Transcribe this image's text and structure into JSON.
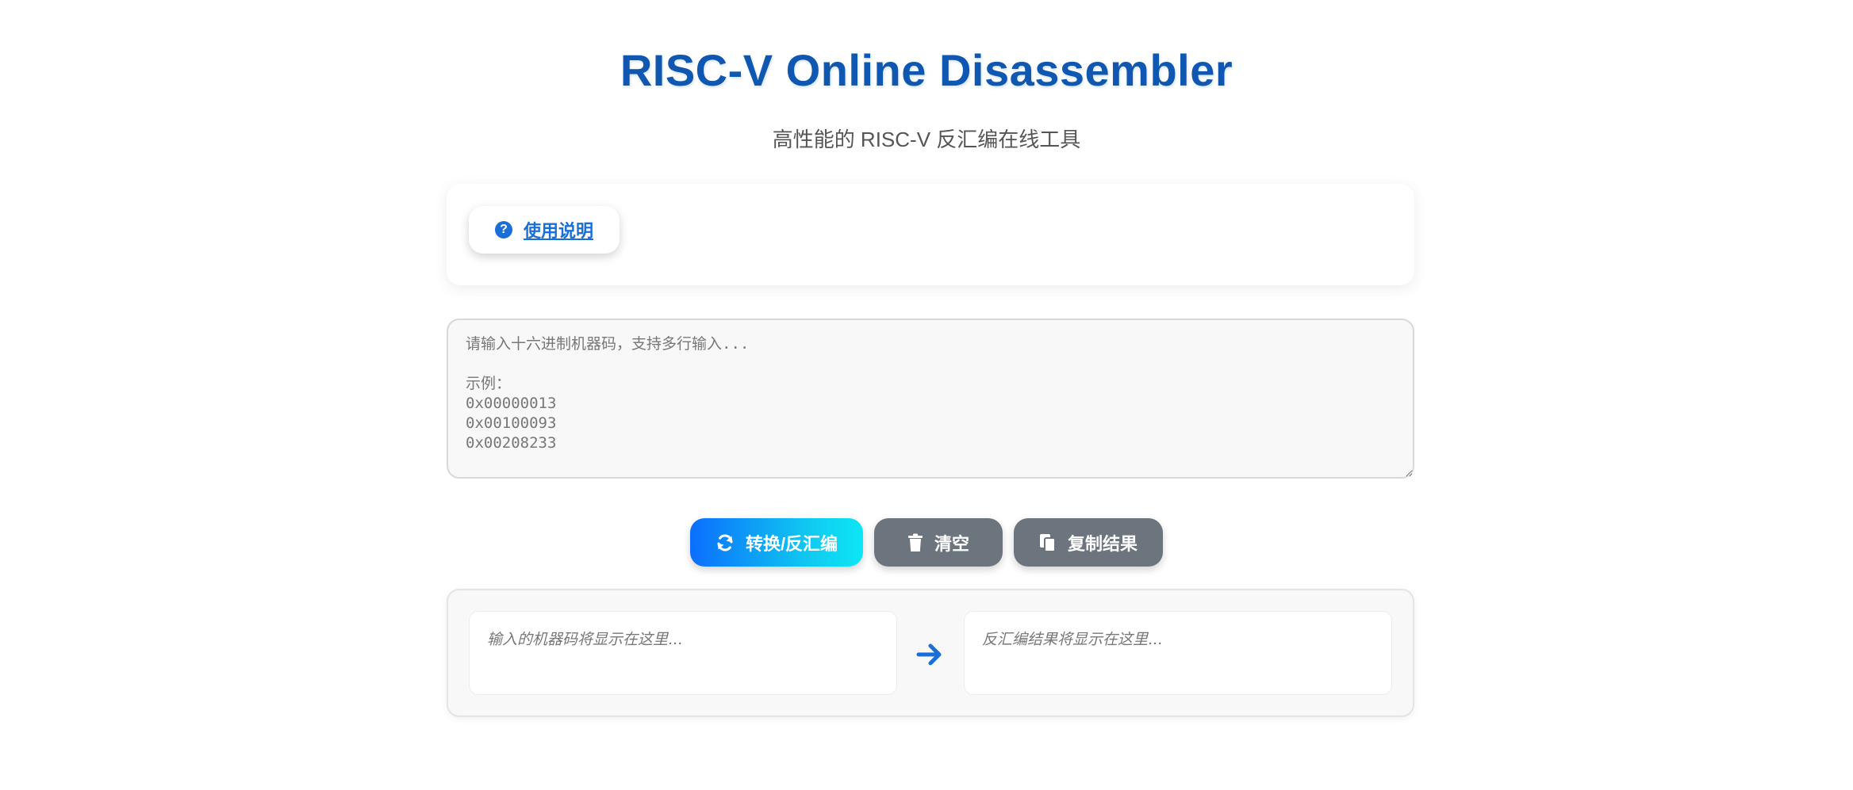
{
  "header": {
    "title": "RISC-V Online Disassembler",
    "subtitle": "高性能的 RISC-V 反汇编在线工具"
  },
  "help": {
    "label": "使用说明",
    "icon": "question-circle-icon"
  },
  "input": {
    "value": "",
    "placeholder": "请输入十六进制机器码，支持多行输入...\n\n示例：\n0x00000013\n0x00100093\n0x00208233"
  },
  "actions": {
    "convert_label": "转换/反汇编",
    "convert_icon": "refresh-icon",
    "clear_label": "清空",
    "clear_icon": "trash-icon",
    "copy_label": "复制结果",
    "copy_icon": "copy-icon"
  },
  "result": {
    "input_placeholder": "输入的机器码将显示在这里...",
    "output_placeholder": "反汇编结果将显示在这里...",
    "arrow_icon": "arrow-right-icon"
  },
  "colors": {
    "title": "#0f57b0",
    "accent": "#1a6fd6",
    "primary_gradient_start": "#0b6efd",
    "primary_gradient_end": "#0de6f5",
    "secondary_button": "#6c757d"
  }
}
